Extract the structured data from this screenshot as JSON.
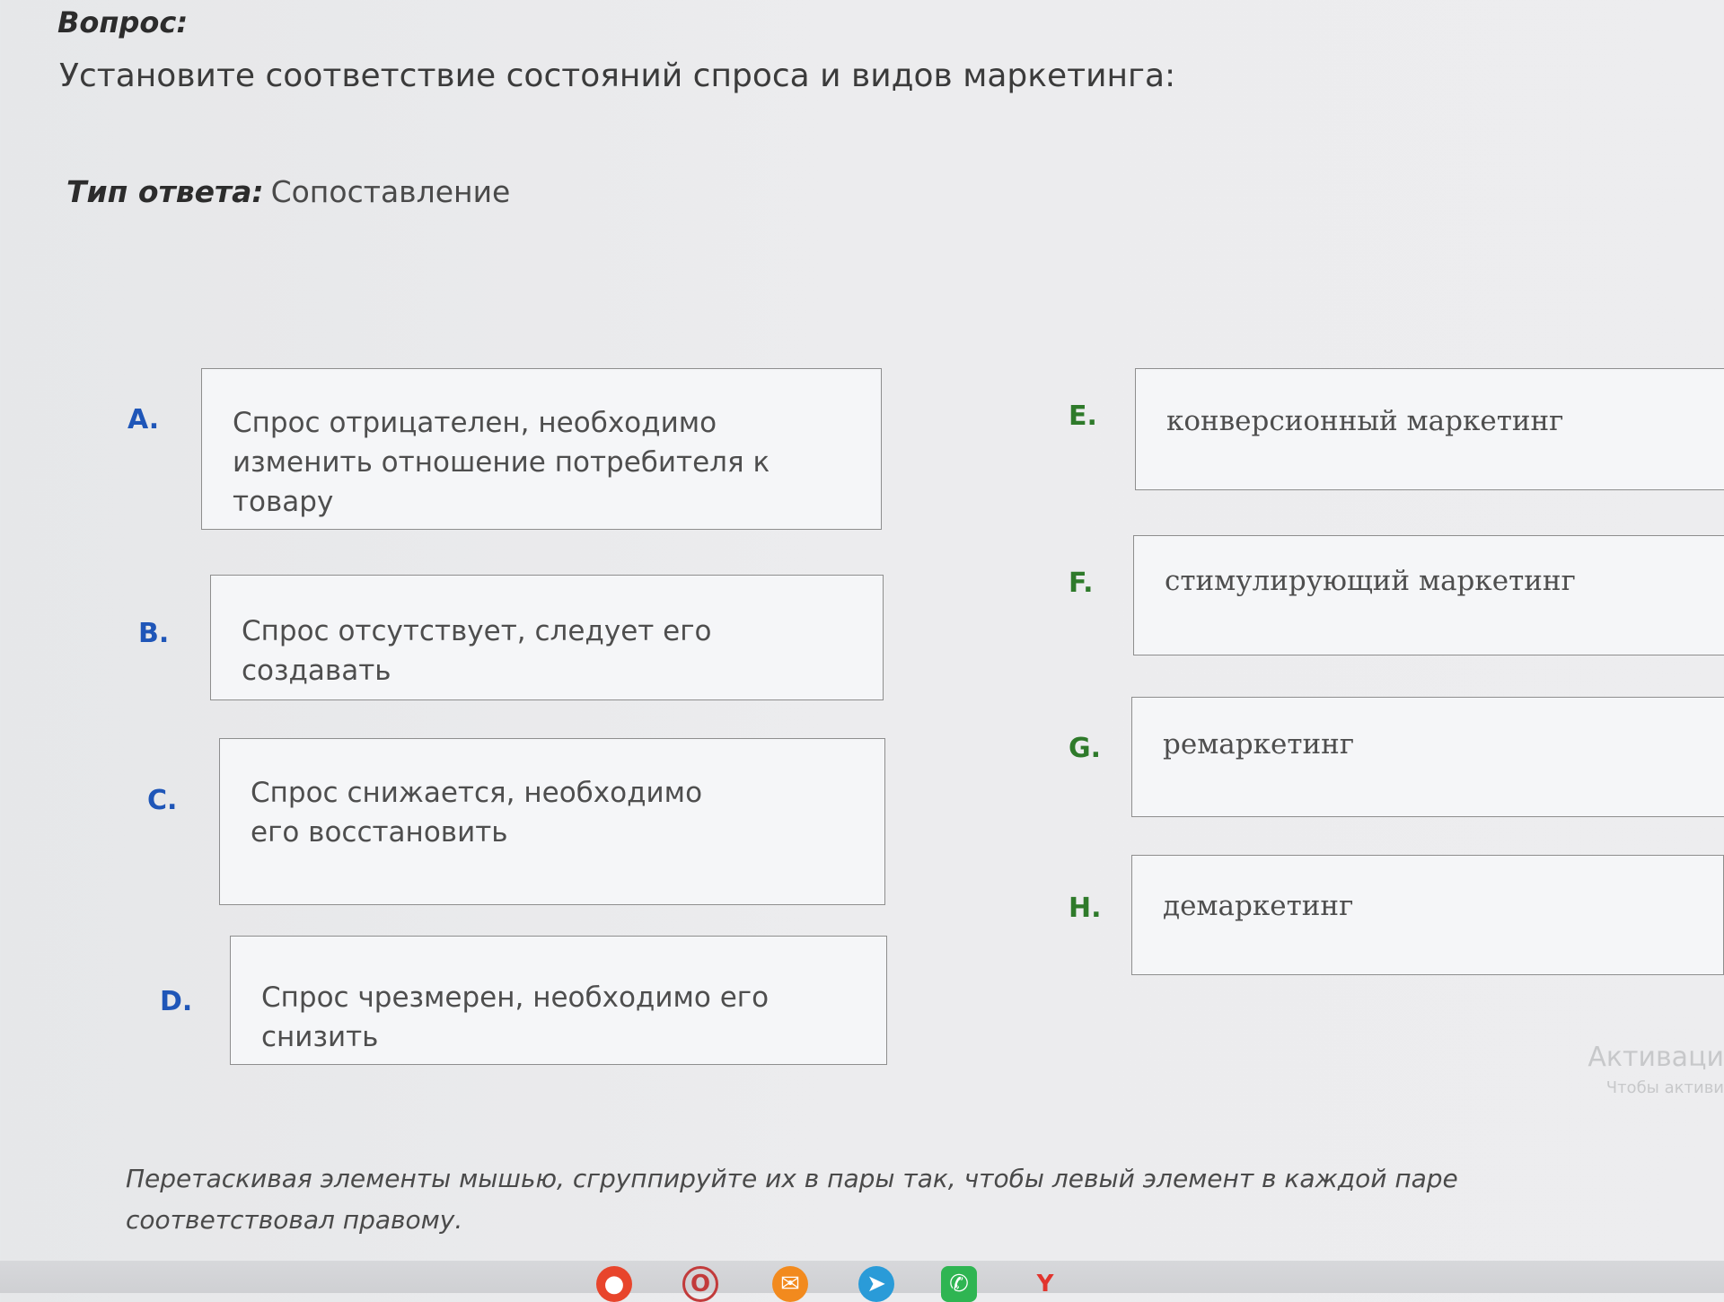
{
  "question": {
    "label": "Вопрос:",
    "text": "Установите соответствие состояний спроса и видов маркетинга:"
  },
  "answer_type": {
    "label": "Тип ответа:",
    "value": "Сопоставление"
  },
  "left_items": [
    {
      "letter": "A.",
      "text": "Спрос отрицателен, необходимо изменить отношение потребителя к товару"
    },
    {
      "letter": "B.",
      "text": "Спрос отсутствует, следует его создавать"
    },
    {
      "letter": "C.",
      "text": "Спрос снижается, необходимо его восстановить"
    },
    {
      "letter": "D.",
      "text": "Спрос чрезмерен, необходимо его снизить"
    }
  ],
  "right_items": [
    {
      "letter": "E.",
      "text": "конверсионный маркетинг"
    },
    {
      "letter": "F.",
      "text": "стимулирующий маркетинг"
    },
    {
      "letter": "G.",
      "text": "ремаркетинг"
    },
    {
      "letter": "H.",
      "text": "демаркетинг"
    }
  ],
  "instruction": "Перетаскивая элементы мышью, сгруппируйте их в пары так, чтобы левый элемент в каждой паре соответствовал правому.",
  "watermark": {
    "line1": "Активаци",
    "line2": "Чтобы активи"
  },
  "taskbar": {
    "icons": [
      "browser-icon",
      "opera-icon",
      "mail-icon",
      "telegram-icon",
      "whatsapp-icon",
      "yandex-icon"
    ],
    "colors": {
      "letter_left": "#1f56b8",
      "letter_right": "#2e7a2a"
    }
  }
}
